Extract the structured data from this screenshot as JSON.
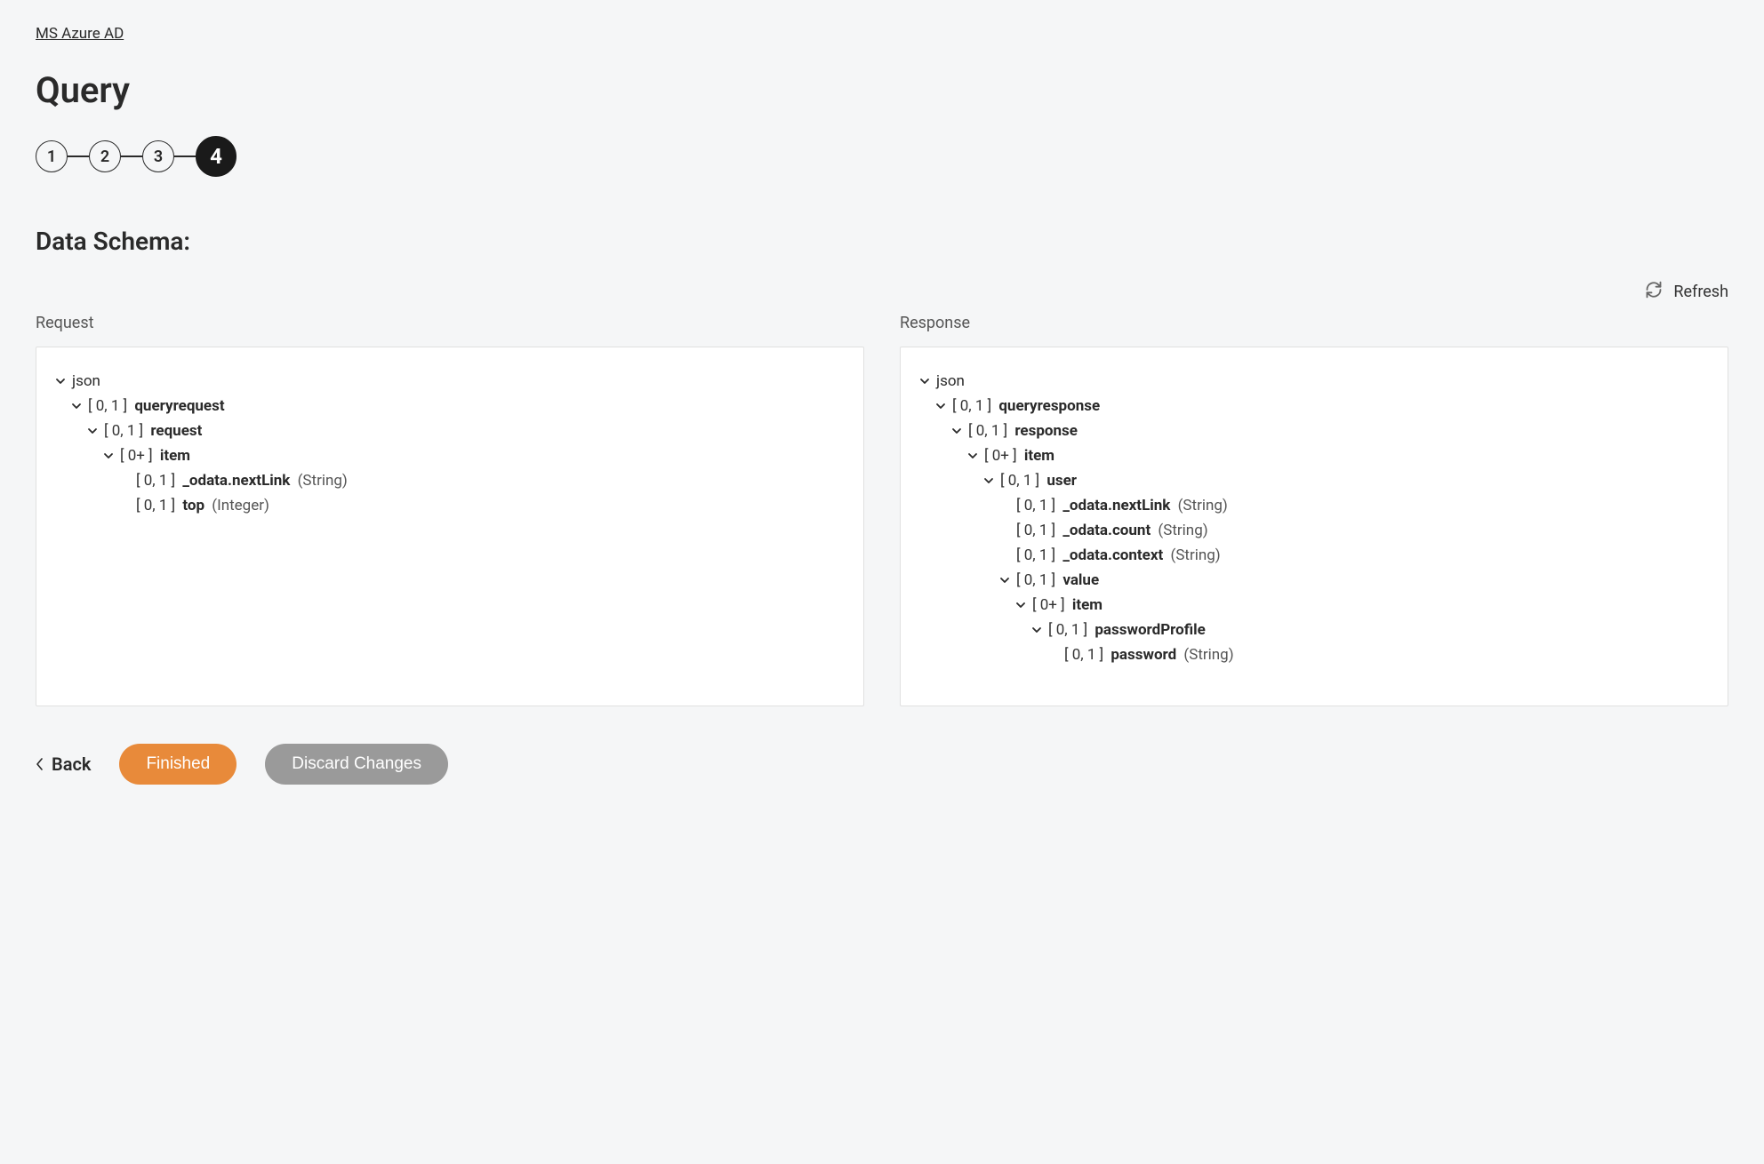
{
  "breadcrumb": {
    "label": "MS Azure AD"
  },
  "page": {
    "title": "Query"
  },
  "stepper": {
    "steps": [
      "1",
      "2",
      "3",
      "4"
    ],
    "active_index": 3
  },
  "section": {
    "title": "Data Schema:"
  },
  "refresh": {
    "label": "Refresh"
  },
  "panels": {
    "request": {
      "title": "Request",
      "tree": {
        "label": "json",
        "cardinality": null,
        "type": null,
        "expanded": true,
        "children": [
          {
            "label": "queryrequest",
            "cardinality": "[ 0, 1 ]",
            "type": null,
            "expanded": true,
            "children": [
              {
                "label": "request",
                "cardinality": "[ 0, 1 ]",
                "type": null,
                "expanded": true,
                "children": [
                  {
                    "label": "item",
                    "cardinality": "[ 0+ ]",
                    "type": null,
                    "expanded": true,
                    "children": [
                      {
                        "label": "_odata.nextLink",
                        "cardinality": "[ 0, 1 ]",
                        "type": "(String)",
                        "children": []
                      },
                      {
                        "label": "top",
                        "cardinality": "[ 0, 1 ]",
                        "type": "(Integer)",
                        "children": []
                      }
                    ]
                  }
                ]
              }
            ]
          }
        ]
      }
    },
    "response": {
      "title": "Response",
      "tree": {
        "label": "json",
        "cardinality": null,
        "type": null,
        "expanded": true,
        "children": [
          {
            "label": "queryresponse",
            "cardinality": "[ 0, 1 ]",
            "type": null,
            "expanded": true,
            "children": [
              {
                "label": "response",
                "cardinality": "[ 0, 1 ]",
                "type": null,
                "expanded": true,
                "children": [
                  {
                    "label": "item",
                    "cardinality": "[ 0+ ]",
                    "type": null,
                    "expanded": true,
                    "children": [
                      {
                        "label": "user",
                        "cardinality": "[ 0, 1 ]",
                        "type": null,
                        "expanded": true,
                        "children": [
                          {
                            "label": "_odata.nextLink",
                            "cardinality": "[ 0, 1 ]",
                            "type": "(String)",
                            "children": []
                          },
                          {
                            "label": "_odata.count",
                            "cardinality": "[ 0, 1 ]",
                            "type": "(String)",
                            "children": []
                          },
                          {
                            "label": "_odata.context",
                            "cardinality": "[ 0, 1 ]",
                            "type": "(String)",
                            "children": []
                          },
                          {
                            "label": "value",
                            "cardinality": "[ 0, 1 ]",
                            "type": null,
                            "expanded": true,
                            "children": [
                              {
                                "label": "item",
                                "cardinality": "[ 0+ ]",
                                "type": null,
                                "expanded": true,
                                "children": [
                                  {
                                    "label": "passwordProfile",
                                    "cardinality": "[ 0, 1 ]",
                                    "type": null,
                                    "expanded": true,
                                    "children": [
                                      {
                                        "label": "password",
                                        "cardinality": "[ 0, 1 ]",
                                        "type": "(String)",
                                        "children": []
                                      }
                                    ]
                                  }
                                ]
                              }
                            ]
                          }
                        ]
                      }
                    ]
                  }
                ]
              }
            ]
          }
        ]
      }
    }
  },
  "footer": {
    "back": "Back",
    "finished": "Finished",
    "discard": "Discard Changes"
  }
}
